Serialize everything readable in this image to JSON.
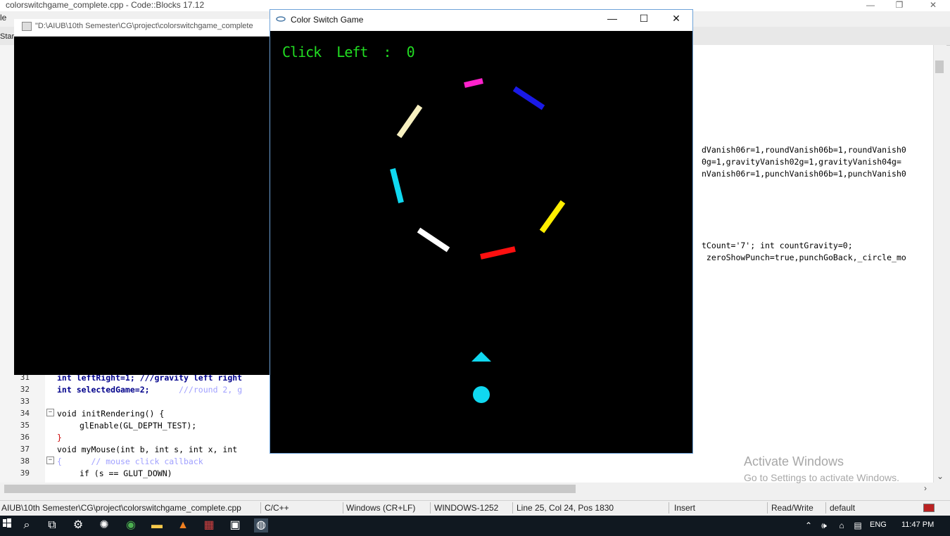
{
  "codeblocks": {
    "title": "colorswitchgame_complete.cpp - Code::Blocks 17.12",
    "menu_stub": "le",
    "start_tab": "Star",
    "line_numbers": [
      "31",
      "32",
      "33",
      "34",
      "35",
      "36",
      "37",
      "38",
      "39"
    ],
    "right_code_lines": [
      "dVanish06r=1,roundVanish06b=1,roundVanish0",
      "0g=1,gravityVanish02g=1,gravityVanish04g=",
      "nVanish06r=1,punchVanish06b=1,punchVanish0",
      "tCount='7'; int countGravity=0;",
      " zeroShowPunch=true,punchGoBack,_circle_mo"
    ],
    "left_code": {
      "l31": "int leftRight=1; ///gravity left right",
      "l32_a": "int selectedGame=2;",
      "l32_b": "///round 2, g",
      "l34": "void initRendering() {",
      "l35": "glEnable(GL_DEPTH_TEST);",
      "l36": "}",
      "l37": "void myMouse(int b, int s, int x, int",
      "l38": "{      // mouse click callback",
      "l39": "if (s == GLUT_DOWN)"
    },
    "status": {
      "path": "AIUB\\10th Semester\\CG\\project\\colorswitchgame_complete.cpp",
      "lang": "C/C++",
      "eol": "Windows (CR+LF)",
      "encoding": "WINDOWS-1252",
      "position": "Line 25, Col 24, Pos 1830",
      "mode": "Insert",
      "access": "Read/Write",
      "profile": "default"
    }
  },
  "console": {
    "title": "\"D:\\AIUB\\10th Semester\\CG\\project\\colorswitchgame_complete"
  },
  "game": {
    "title": "Color Switch Game",
    "click_left_label": "Click  Left  :  0",
    "colors": {
      "magenta": "#ff22cc",
      "blue": "#1a1ae6",
      "yellow": "#ffee00",
      "red": "#ff1010",
      "white": "#ffffff",
      "cyan": "#10d8f0",
      "cream": "#f7f0c0",
      "text_green": "#22dd22"
    }
  },
  "watermark": {
    "title": "Activate Windows",
    "subtitle": "Go to Settings to activate Windows."
  },
  "taskbar": {
    "lang": "ENG",
    "time": "11:47 PM"
  }
}
